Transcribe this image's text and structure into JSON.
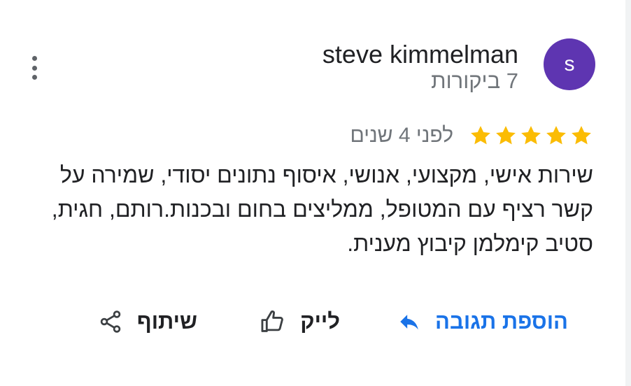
{
  "reviewer": {
    "name": "steve kimmelman",
    "reviews_count_label": "7 ביקורות",
    "avatar_letter": "s",
    "avatar_color": "#5e35b1"
  },
  "review": {
    "rating": 5,
    "max_rating": 5,
    "time_ago": "לפני 4 שנים",
    "text": "שירות אישי, מקצועי, אנושי, איסוף נתונים יסודי, שמירה על קשר רציף עם המטופל, ממליצים בחום ובכנות.רותם, חגית, סטיב קימלמן קיבוץ מענית."
  },
  "actions": {
    "reply_label": "הוספת תגובה",
    "like_label": "לייק",
    "share_label": "שיתוף"
  },
  "icons": {
    "more": "more-vert-icon",
    "star": "star-icon",
    "reply": "reply-icon",
    "like": "thumb-up-icon",
    "share": "share-icon"
  },
  "colors": {
    "star": "#fbbc04",
    "accent": "#1a73e8",
    "secondary_text": "#70757a"
  }
}
